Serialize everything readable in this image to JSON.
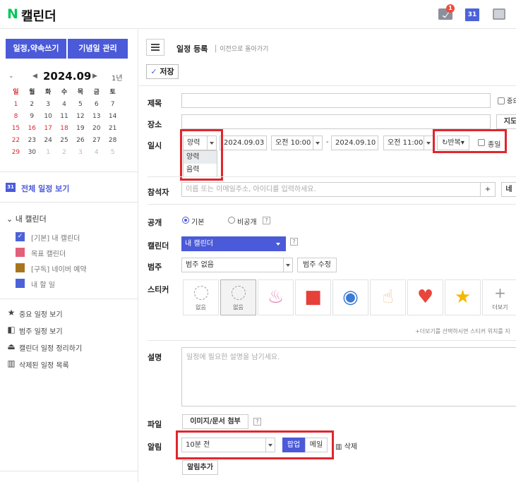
{
  "header": {
    "logo_letter": "N",
    "app_title": "캘린더",
    "notification_count": "1",
    "calendar_icon_day": "31"
  },
  "sidebar": {
    "write_button": "일정,약속쓰기",
    "anniversary_button": "기념일 관리",
    "mini_calendar": {
      "month": "2024.09",
      "year_toggle": "1년",
      "weekday_headers": [
        "일",
        "월",
        "화",
        "수",
        "목",
        "금",
        "토"
      ],
      "weeks": [
        [
          "1",
          "2",
          "3",
          "4",
          "5",
          "6",
          "7"
        ],
        [
          "8",
          "9",
          "10",
          "11",
          "12",
          "13",
          "14"
        ],
        [
          "15",
          "16",
          "17",
          "18",
          "19",
          "20",
          "21"
        ],
        [
          "22",
          "23",
          "24",
          "25",
          "26",
          "27",
          "28"
        ],
        [
          "29",
          "30",
          "1",
          "2",
          "3",
          "4",
          "5"
        ]
      ]
    },
    "all_schedule_label": "전체 일정 보기",
    "my_calendar_header": "내 캘린더",
    "calendars": [
      {
        "label": "[기본] 내 캘린더",
        "color": "#4b63d9"
      },
      {
        "label": "목표 캘린더",
        "color": "#e2607a"
      },
      {
        "label": "[구독] 네이버 예약",
        "color": "#a9741f"
      },
      {
        "label": "내 할 일",
        "color": "#4b63d9"
      }
    ],
    "tools": [
      {
        "label": "중요 일정 보기",
        "icon": "star-icon"
      },
      {
        "label": "범주 일정 보기",
        "icon": "category-icon"
      },
      {
        "label": "캘린더 일정 정리하기",
        "icon": "organize-icon"
      },
      {
        "label": "삭제된 일정 목록",
        "icon": "trash-icon"
      }
    ]
  },
  "main": {
    "page_title": "일정 등록",
    "back_link": "이전으로 돌아가기",
    "save_button": "저장",
    "fields": {
      "title_label": "제목",
      "important_label": "중요",
      "place_label": "장소",
      "map_button": "지도",
      "datetime_label": "일시",
      "calendar_type": "양력",
      "calendar_type_options": [
        "양력",
        "음력"
      ],
      "start_date": "2024.09.03",
      "start_time": "오전 10:00",
      "end_date": "2024.09.10",
      "end_time": "오전 11:00",
      "date_separator": "-",
      "repeat_button": "반복",
      "allday_label": "종일",
      "attendee_label": "참석자",
      "attendee_placeholder": "이름 또는 이메일주소, 아이디를 입력하세요.",
      "attendee_add": "+",
      "attendee_extra": "네",
      "visibility_label": "공개",
      "visibility_default": "기본",
      "visibility_private": "비공개",
      "calendar_label": "캘린더",
      "calendar_value": "내 캘린더",
      "category_label": "범주",
      "category_value": "범주 없음",
      "category_edit": "범주 수정",
      "sticker_label": "스티커",
      "stickers": [
        "없음",
        "없음",
        "",
        "",
        "",
        "",
        "",
        "",
        "더보기"
      ],
      "sticker_hint": "+더보기를 선택하시면 스티커 위치를 지",
      "description_label": "설명",
      "description_placeholder": "일정에 필요한 설명을 남기세요.",
      "file_label": "파일",
      "file_button": "이미지/문서 첨부",
      "alarm_label": "알림",
      "alarm_value": "10분 전",
      "alarm_popup": "팝업",
      "alarm_mail": "메일",
      "alarm_delete": "삭제",
      "alarm_add": "알림추가"
    }
  }
}
